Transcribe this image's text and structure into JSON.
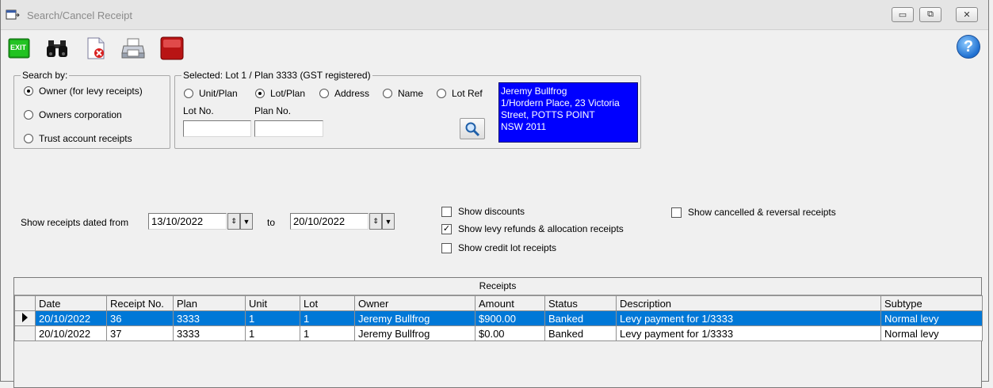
{
  "window": {
    "title": "Search/Cancel Receipt",
    "controls": {
      "minimize": "▭",
      "maximize": "⧉",
      "close": "✕"
    }
  },
  "toolbar": {
    "exit_label": "EXIT",
    "icons": [
      "exit-icon",
      "binoculars-icon",
      "cancel-document-icon",
      "printer-icon",
      "stop-icon"
    ],
    "help_label": "?"
  },
  "search_by": {
    "legend": "Search by:",
    "options": [
      {
        "label": "Owner (for levy receipts)",
        "selected": true
      },
      {
        "label": "Owners corporation",
        "selected": false
      },
      {
        "label": "Trust account receipts",
        "selected": false
      }
    ]
  },
  "selected": {
    "legend": "Selected:  Lot 1 / Plan 3333  (GST registered)",
    "options": [
      {
        "label": "Unit/Plan",
        "selected": false
      },
      {
        "label": "Lot/Plan",
        "selected": true
      },
      {
        "label": "Address",
        "selected": false
      },
      {
        "label": "Name",
        "selected": false
      },
      {
        "label": "Lot Ref",
        "selected": false
      }
    ],
    "lot_label": "Lot No.",
    "plan_label": "Plan No.",
    "lot_value": "",
    "plan_value": "",
    "owner_lines": [
      "Jeremy Bullfrog",
      "1/Hordern Place, 23 Victoria",
      "Street, POTTS POINT",
      "NSW  2011"
    ]
  },
  "date_filter": {
    "from_label": "Show receipts dated from",
    "from_value": "13/10/2022",
    "to_label": "to",
    "to_value": "20/10/2022"
  },
  "options": {
    "show_discounts": {
      "label": "Show discounts",
      "checked": false
    },
    "show_levy_refunds": {
      "label": "Show levy refunds & allocation receipts",
      "checked": true
    },
    "show_credit_lot": {
      "label": "Show credit lot receipts",
      "checked": false
    },
    "show_cancelled": {
      "label": "Show cancelled & reversal receipts",
      "checked": false
    }
  },
  "receipts": {
    "caption": "Receipts",
    "columns": [
      "Date",
      "Receipt No.",
      "Plan",
      "Unit",
      "Lot",
      "Owner",
      "Amount",
      "Status",
      "Description",
      "Subtype"
    ],
    "rows": [
      {
        "selected": true,
        "cells": [
          "20/10/2022",
          "36",
          "3333",
          "1",
          "1",
          "Jeremy  Bullfrog",
          "$900.00",
          "Banked",
          "Levy payment for 1/3333",
          "Normal levy"
        ]
      },
      {
        "selected": false,
        "cells": [
          "20/10/2022",
          "37",
          "3333",
          "1",
          "1",
          "Jeremy  Bullfrog",
          "$0.00",
          "Banked",
          "Levy payment for 1/3333",
          "Normal levy"
        ]
      }
    ]
  },
  "colors": {
    "selection": "#0078d7",
    "owner_box": "#0000ff"
  }
}
